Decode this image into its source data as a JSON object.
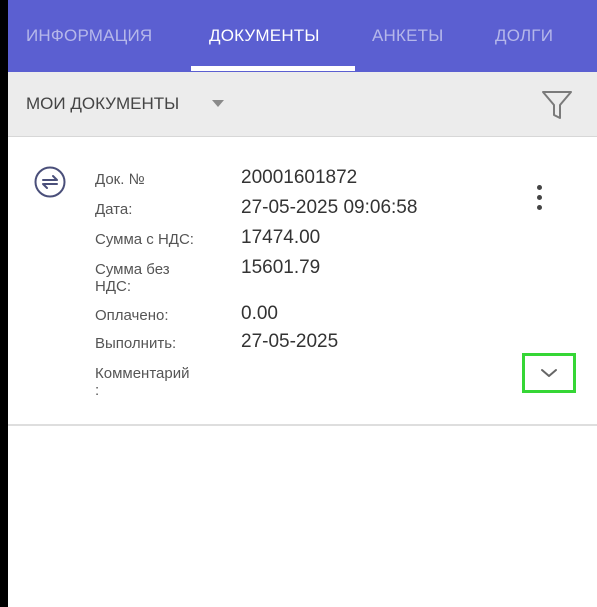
{
  "tabs": [
    "ИНФОРМАЦИЯ",
    "ДОКУМЕНТЫ",
    "АНКЕТЫ",
    "ДОЛГИ"
  ],
  "active_tab": "ДОКУМЕНТЫ",
  "colors": {
    "tabbar": "#5b5fd1",
    "highlight": "#35d635"
  },
  "subbar": {
    "title": "МОИ ДОКУМЕНТЫ",
    "dropdown_icon": "caret-down-icon",
    "filter_icon": "filter-icon"
  },
  "document": {
    "type_icon": "swap-arrows-icon",
    "labels": {
      "doc_no": "Док. №",
      "date": "Дата:",
      "sum_vat": "Сумма с НДС:",
      "sum_no_vat_line1": "Сумма без",
      "sum_no_vat_line2": "НДС:",
      "paid": "Оплачено:",
      "execute": "Выполнить:",
      "comment_line1": "Комментарий",
      "comment_line2": ":"
    },
    "values": {
      "doc_no": "20001601872",
      "date": "27-05-2025 09:06:58",
      "sum_vat": "17474.00",
      "sum_no_vat": "15601.79",
      "paid": "0.00",
      "execute": "27-05-2025",
      "comment": ""
    },
    "menu_icon": "more-vert-icon",
    "expand_icon": "chevron-down-icon"
  }
}
